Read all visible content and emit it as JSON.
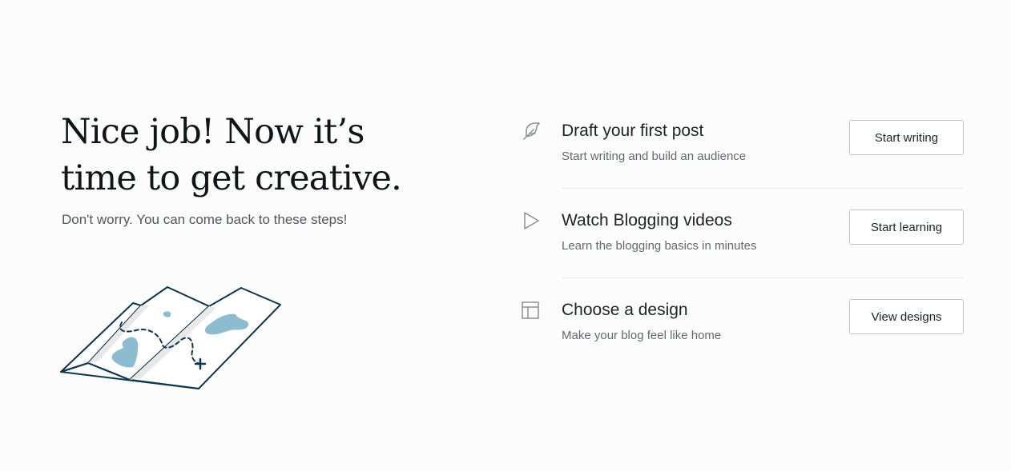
{
  "hero": {
    "title": "Nice job! Now it’s time to get creative.",
    "subtitle": "Don't worry. You can come back to these steps!",
    "illustration": "folded-map-illustration"
  },
  "steps": [
    {
      "icon": "feather-icon",
      "title": "Draft your first post",
      "description": "Start writing and build an audience",
      "button_label": "Start writing"
    },
    {
      "icon": "play-icon",
      "title": "Watch Blogging videos",
      "description": "Learn the blogging basics in minutes",
      "button_label": "Start learning"
    },
    {
      "icon": "layout-icon",
      "title": "Choose a design",
      "description": "Make your blog feel like home",
      "button_label": "View designs"
    }
  ],
  "colors": {
    "background": "#fcfcfc",
    "text_primary": "#101517",
    "text_secondary": "#646970",
    "map_outline": "#0c3551",
    "map_water": "#8dbcd1",
    "icon": "#8c8f94"
  }
}
